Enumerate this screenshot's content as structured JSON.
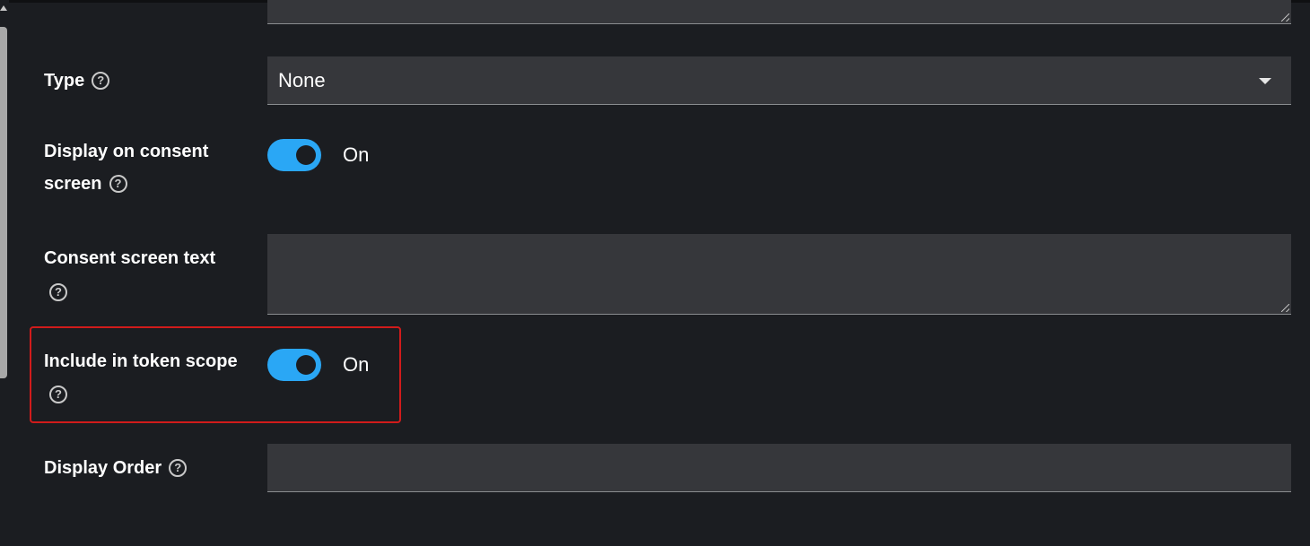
{
  "form": {
    "type": {
      "label": "Type",
      "value": "None"
    },
    "display_on_consent_screen": {
      "label_line1": "Display on consent",
      "label_line2": "screen",
      "state": "On"
    },
    "consent_screen_text": {
      "label": "Consent screen text",
      "value": ""
    },
    "include_in_token_scope": {
      "label": "Include in token scope",
      "state": "On"
    },
    "display_order": {
      "label": "Display Order",
      "value": ""
    }
  },
  "icons": {
    "help": "?"
  },
  "colors": {
    "background": "#1b1d21",
    "field_background": "#36373b",
    "toggle_on": "#2aa7f5",
    "highlight_border": "#d11b1b"
  }
}
